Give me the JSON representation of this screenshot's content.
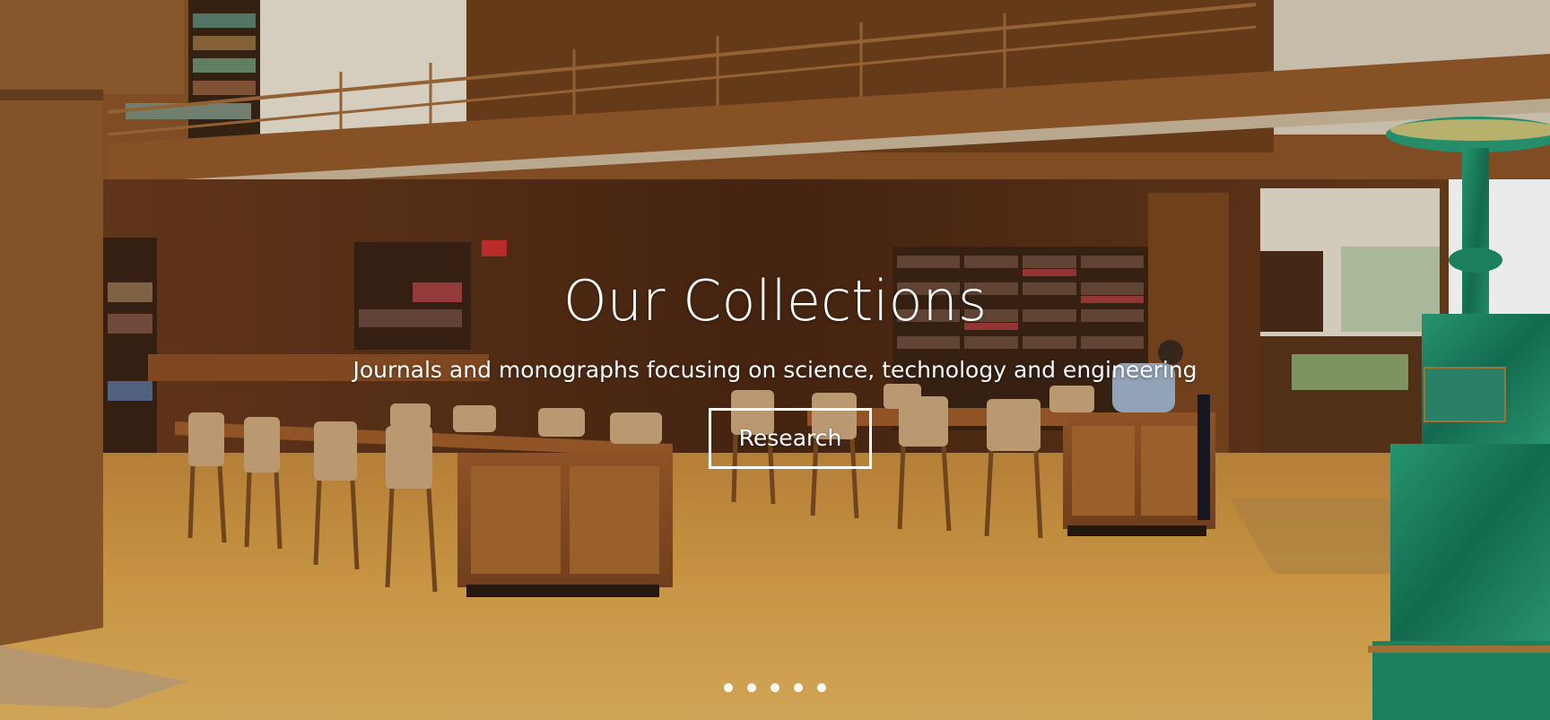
{
  "slide": {
    "title": "Our Collections",
    "subtitle": "Journals and monographs focusing on science, technology and engineering",
    "button_label": "Research"
  },
  "carousel": {
    "slide_count": 5,
    "active_index": 0,
    "indicator_color": "#ffffff"
  },
  "background": {
    "scene": "library-reading-room-photo",
    "wood_color": "#7a4520",
    "floor_color": "#d9a24a",
    "malachite_color": "#1f8a66"
  }
}
